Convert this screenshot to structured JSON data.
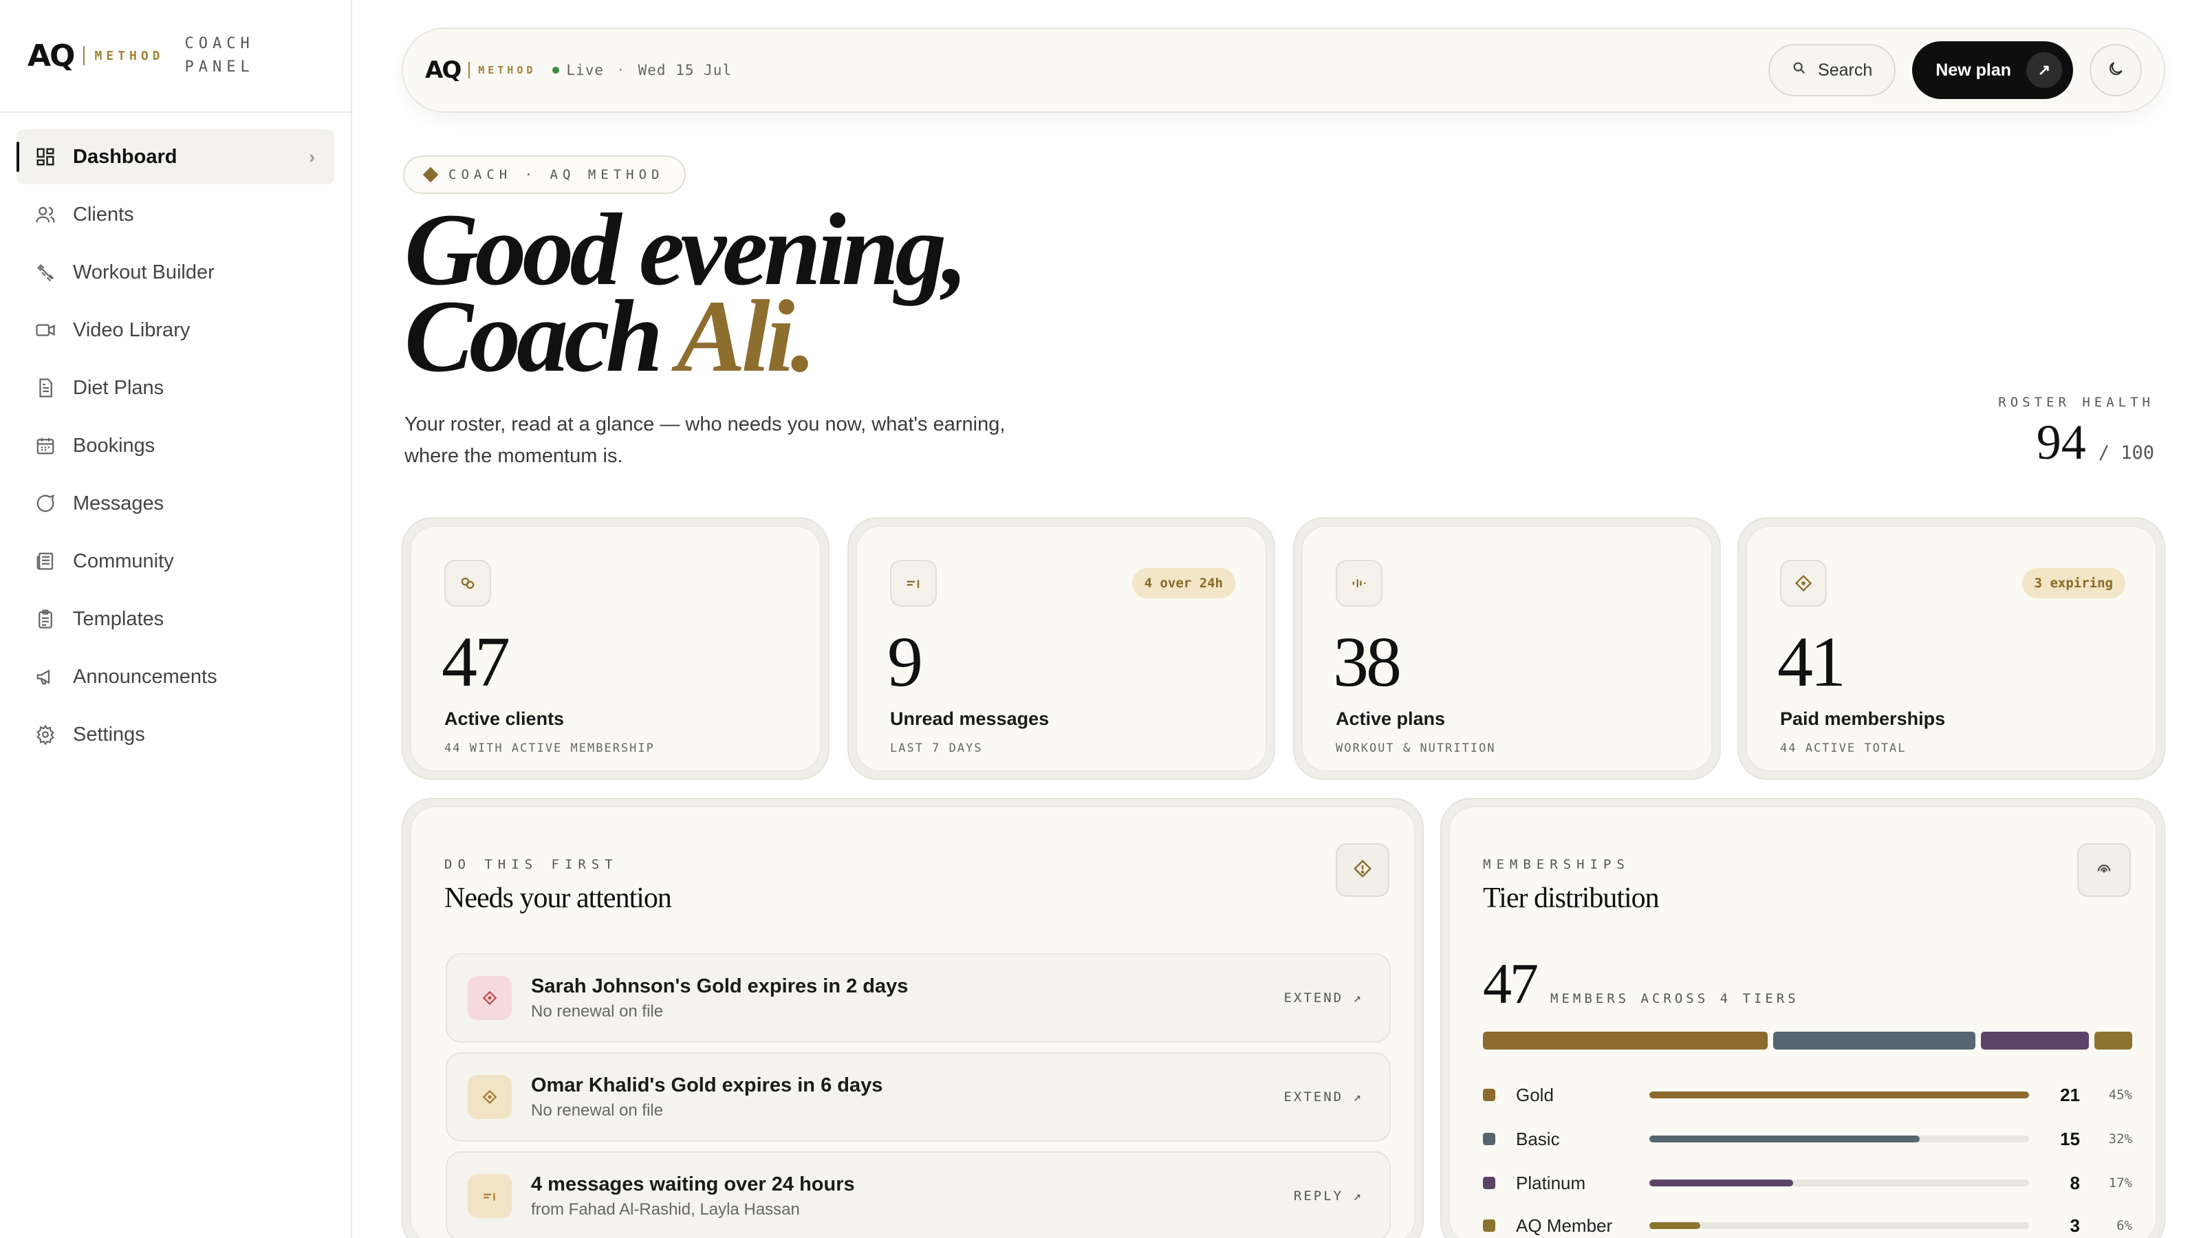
{
  "brand": {
    "aq": "AQ",
    "method": "METHOD",
    "panel_line1": "COACH",
    "panel_line2": "PANEL"
  },
  "sidebar": {
    "items": [
      {
        "label": "Dashboard",
        "icon": "dashboard-icon",
        "active": true
      },
      {
        "label": "Clients",
        "icon": "users-icon"
      },
      {
        "label": "Workout Builder",
        "icon": "dumbbell-icon"
      },
      {
        "label": "Video Library",
        "icon": "video-icon"
      },
      {
        "label": "Diet Plans",
        "icon": "document-icon"
      },
      {
        "label": "Bookings",
        "icon": "calendar-icon"
      },
      {
        "label": "Messages",
        "icon": "message-icon"
      },
      {
        "label": "Community",
        "icon": "newspaper-icon"
      },
      {
        "label": "Templates",
        "icon": "clipboard-icon"
      },
      {
        "label": "Announcements",
        "icon": "megaphone-icon"
      },
      {
        "label": "Settings",
        "icon": "gear-icon"
      }
    ]
  },
  "topbar": {
    "live": "Live",
    "sep": "·",
    "date": "Wed 15 Jul",
    "search_label": "Search",
    "new_plan_label": "New plan"
  },
  "hero": {
    "pill": "COACH · AQ METHOD",
    "greeting": "Good evening,",
    "coach_prefix": "Coach",
    "coach_name": "Ali.",
    "subtitle": "Your roster, read at a glance — who needs you now, what's earning, where the momentum is.",
    "health_label": "ROSTER HEALTH",
    "health_value": "94",
    "health_max": "/ 100"
  },
  "stats": [
    {
      "value": "47",
      "label": "Active clients",
      "sub": "44 WITH ACTIVE MEMBERSHIP",
      "badge": "",
      "icon": "link-icon"
    },
    {
      "value": "9",
      "label": "Unread messages",
      "sub": "LAST 7 DAYS",
      "badge": "4 over 24h",
      "icon": "message-lines-icon"
    },
    {
      "value": "38",
      "label": "Active plans",
      "sub": "WORKOUT & NUTRITION",
      "badge": "",
      "icon": "bars-icon"
    },
    {
      "value": "41",
      "label": "Paid memberships",
      "sub": "44 ACTIVE TOTAL",
      "badge": "3 expiring",
      "icon": "diamond-icon"
    }
  ],
  "attention": {
    "eyebrow": "DO THIS FIRST",
    "title": "Needs your attention",
    "tasks": [
      {
        "title": "Sarah Johnson's Gold expires in 2 days",
        "sub": "No renewal on file",
        "action": "EXTEND ↗"
      },
      {
        "title": "Omar Khalid's Gold expires in 6 days",
        "sub": "No renewal on file",
        "action": "EXTEND ↗"
      },
      {
        "title": "4 messages waiting over 24 hours",
        "sub": "from Fahad Al-Rashid, Layla Hassan",
        "action": "REPLY ↗"
      }
    ]
  },
  "memberships": {
    "eyebrow": "MEMBERSHIPS",
    "title": "Tier distribution",
    "total": "47",
    "total_label": "MEMBERS ACROSS 4 TIERS",
    "tiers": [
      {
        "name": "Gold",
        "count": "21",
        "pct": "45%",
        "share": 0.45,
        "color": "#8d6a2e"
      },
      {
        "name": "Basic",
        "count": "15",
        "pct": "32%",
        "share": 0.32,
        "color": "#56656f"
      },
      {
        "name": "Platinum",
        "count": "8",
        "pct": "17%",
        "share": 0.17,
        "color": "#5c4468"
      },
      {
        "name": "AQ Member",
        "count": "3",
        "pct": "6%",
        "share": 0.06,
        "color": "#8d742e"
      }
    ]
  },
  "colors": {
    "accent": "#8d6e2f",
    "ink": "#111111",
    "card": "#faf9f4",
    "live": "#3b8a3e"
  }
}
